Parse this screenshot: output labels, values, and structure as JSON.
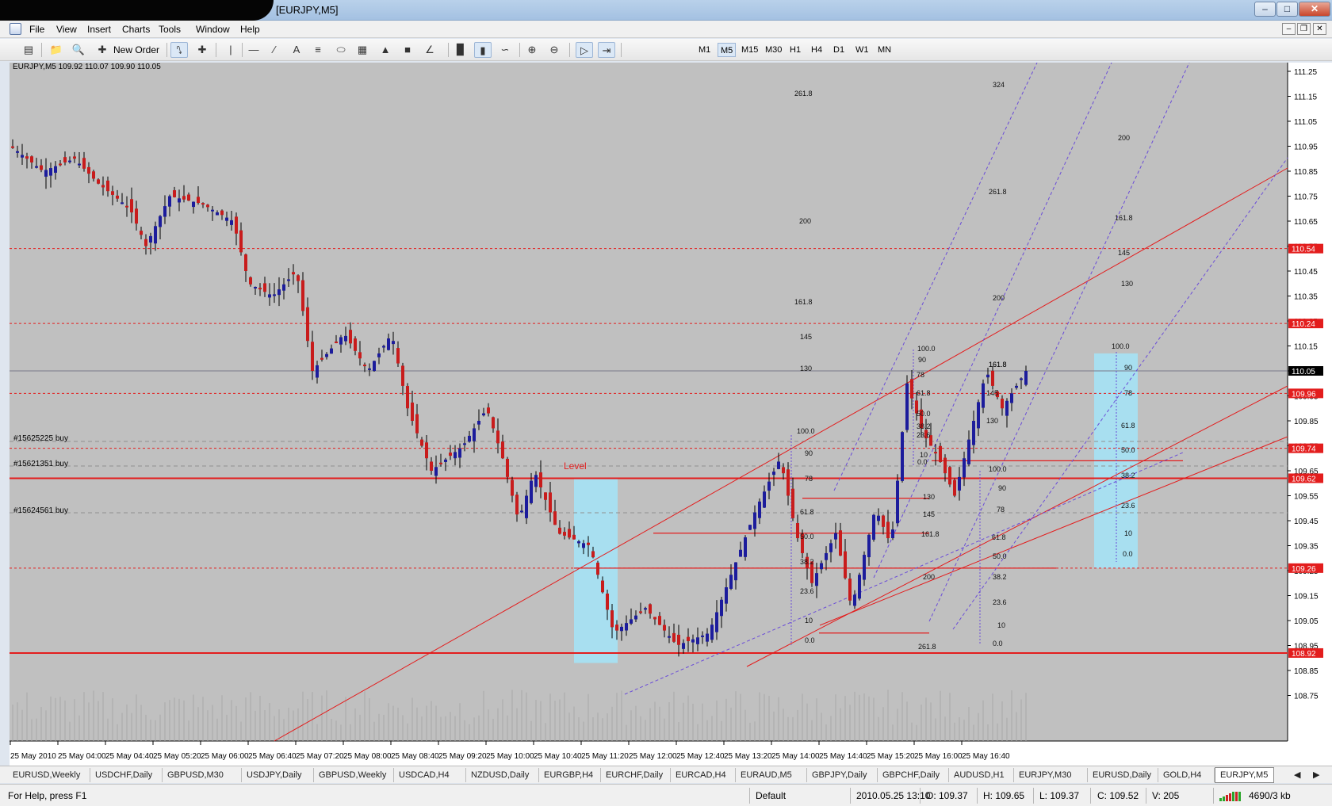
{
  "window": {
    "title": "[EURJPY,M5]"
  },
  "menu": [
    "File",
    "View",
    "Insert",
    "Charts",
    "Tools",
    "Window",
    "Help"
  ],
  "toolbar": {
    "new_order_label": "New Order",
    "timeframes": [
      "M1",
      "M5",
      "M15",
      "M30",
      "H1",
      "H4",
      "D1",
      "W1",
      "MN"
    ],
    "active_timeframe": "M5"
  },
  "chart": {
    "info_label": "EURJPY,M5  109.92 110.07 109.90 110.05",
    "level_label": "Level",
    "orders": [
      "#15625225 buy",
      "#15621351 buy",
      "#15624561 buy"
    ],
    "price_axis": [
      "111.25",
      "111.15",
      "111.05",
      "110.95",
      "110.85",
      "110.75",
      "110.65",
      "110.55",
      "110.45",
      "110.35",
      "110.25",
      "110.15",
      "110.05",
      "109.95",
      "109.85",
      "109.75",
      "109.65",
      "109.55",
      "109.45",
      "109.35",
      "109.25",
      "109.15",
      "109.05",
      "108.95",
      "108.85",
      "108.75"
    ],
    "highlight_prices": [
      {
        "price": "110.54",
        "value": 110.54,
        "color": "#e31d1d"
      },
      {
        "price": "110.24",
        "value": 110.24,
        "color": "#e31d1d"
      },
      {
        "price": "110.05",
        "value": 110.05,
        "color": "#000000"
      },
      {
        "price": "109.96",
        "value": 109.96,
        "color": "#e31d1d"
      },
      {
        "price": "109.74",
        "value": 109.74,
        "color": "#e31d1d"
      },
      {
        "price": "109.62",
        "value": 109.62,
        "color": "#e31d1d"
      },
      {
        "price": "109.26",
        "value": 109.26,
        "color": "#e31d1d"
      },
      {
        "price": "108.92",
        "value": 108.92,
        "color": "#e31d1d"
      }
    ],
    "time_axis": [
      "25 May 2010",
      "25 May 04:00",
      "25 May 04:40",
      "25 May 05:20",
      "25 May 06:00",
      "25 May 06:40",
      "25 May 07:20",
      "25 May 08:00",
      "25 May 08:40",
      "25 May 09:20",
      "25 May 10:00",
      "25 May 10:40",
      "25 May 11:20",
      "25 May 12:00",
      "25 May 12:40",
      "25 May 13:20",
      "25 May 14:00",
      "25 May 14:40",
      "25 May 15:20",
      "25 May 16:00",
      "25 May 16:40"
    ],
    "fib_labels": [
      "261.8",
      "200",
      "161.8",
      "145",
      "130",
      "100.0",
      "90",
      "78",
      "61.8",
      "50.0",
      "38.2",
      "23.6",
      "10",
      "0.0",
      "324",
      "261.8",
      "200",
      "161.8",
      "100.0",
      "90",
      "78",
      "61.8",
      "50.0",
      "38.2",
      "23.6",
      "10",
      "0.0",
      "0.0",
      "10",
      "23.6",
      "38.2",
      "50.0",
      "61.8",
      "78",
      "90",
      "100.0",
      "130",
      "145",
      "161.8",
      "200",
      "261.8",
      "161.8",
      "145",
      "130",
      "200",
      "161.8",
      "145",
      "130",
      "100.0",
      "90",
      "78",
      "61.8",
      "50.0",
      "38.2",
      "23.6",
      "10",
      "0.0"
    ],
    "colors": {
      "background": "#c0c0c0",
      "bull": "#1c1c9c",
      "bear": "#c81c1c",
      "level_line": "#e31d1d",
      "fib_line": "#6a4cd8",
      "highlight_box": "#a8dff0"
    }
  },
  "tabs": [
    "EURUSD,Weekly",
    "USDCHF,Daily",
    "GBPUSD,M30",
    "USDJPY,Daily",
    "GBPUSD,Weekly",
    "USDCAD,H4",
    "NZDUSD,Daily",
    "EURGBP,H4",
    "EURCHF,Daily",
    "EURCAD,H4",
    "EURAUD,M5",
    "GBPJPY,Daily",
    "GBPCHF,Daily",
    "AUDUSD,H1",
    "EURJPY,M30",
    "EURUSD,Daily",
    "GOLD,H4",
    "EURJPY,M5"
  ],
  "active_tab": "EURJPY,M5",
  "status": {
    "help": "For Help, press F1",
    "profile": "Default",
    "datetime": "2010.05.25 13:10",
    "open": "O: 109.37",
    "high": "H: 109.65",
    "low": "L: 109.37",
    "close": "C: 109.52",
    "volume": "V: 205",
    "traffic": "4690/3 kb"
  }
}
